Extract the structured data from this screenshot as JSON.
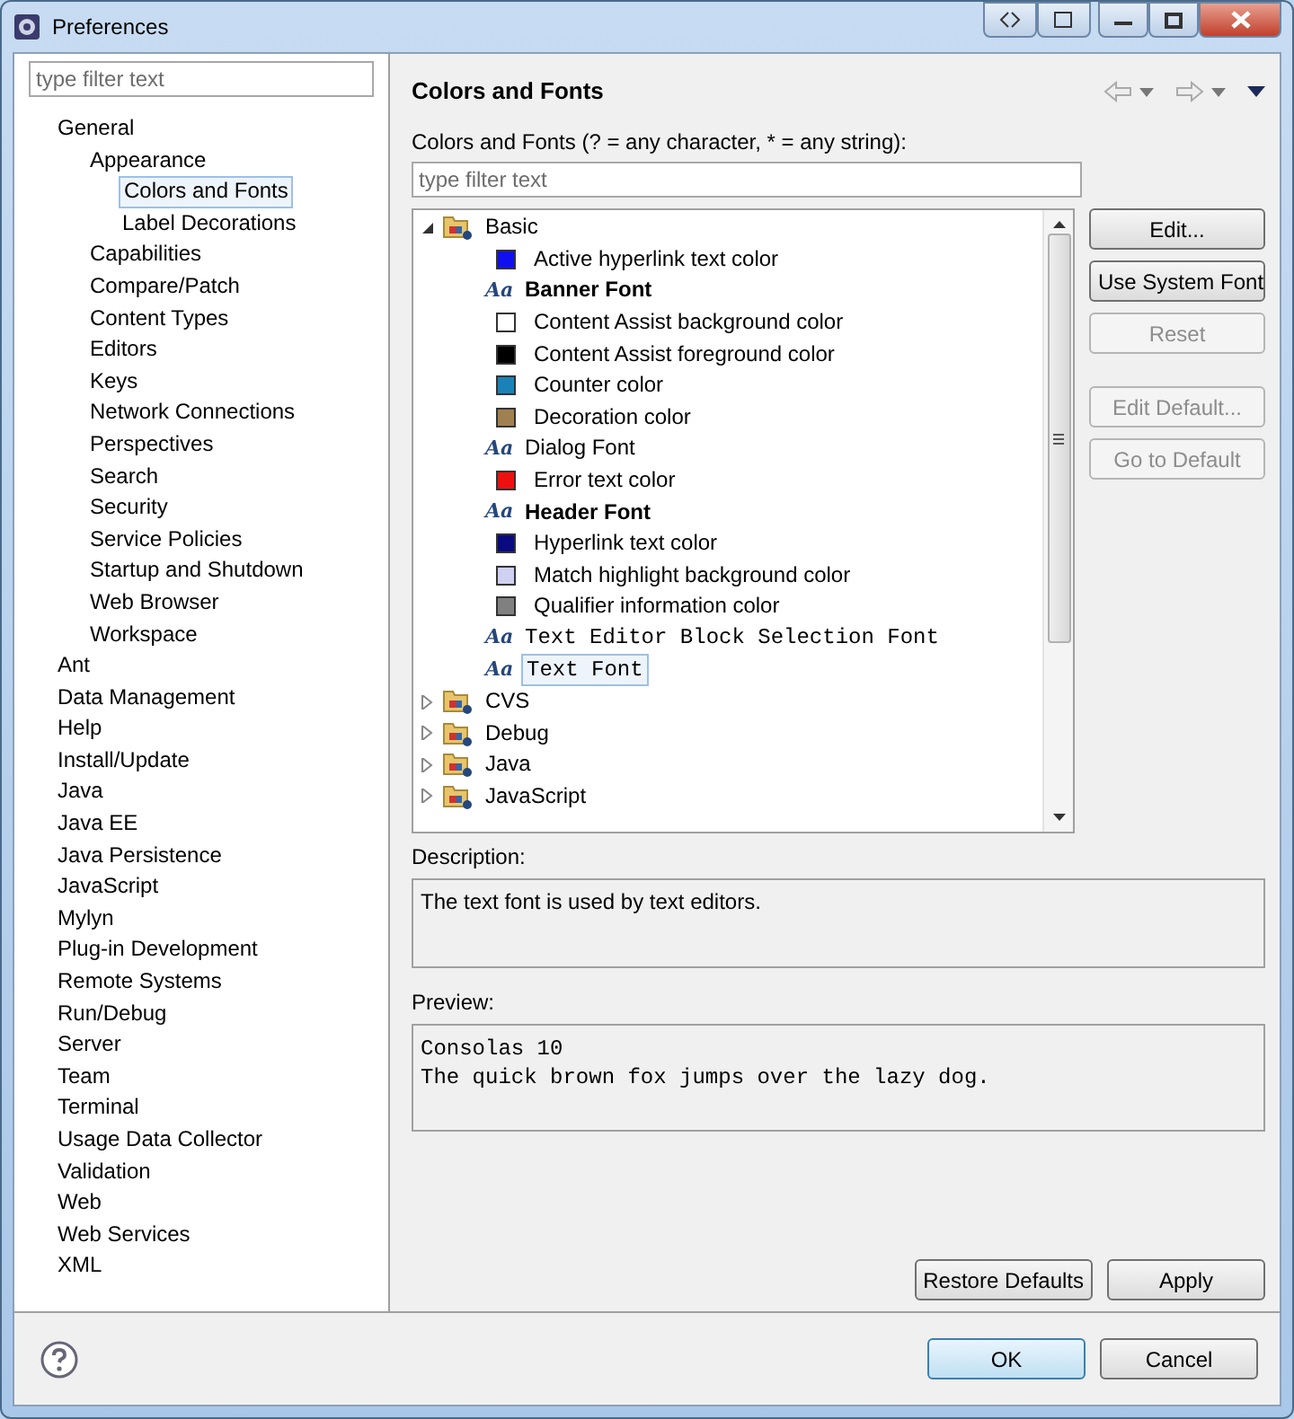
{
  "window": {
    "title": "Preferences"
  },
  "filter": {
    "placeholder": "type filter text"
  },
  "nav_tree": [
    {
      "label": "General",
      "selected": false,
      "children": [
        {
          "label": "Appearance",
          "selected": false,
          "children": [
            {
              "label": "Colors and Fonts",
              "selected": true
            },
            {
              "label": "Label Decorations",
              "selected": false
            }
          ]
        },
        {
          "label": "Capabilities",
          "selected": false
        },
        {
          "label": "Compare/Patch",
          "selected": false
        },
        {
          "label": "Content Types",
          "selected": false
        },
        {
          "label": "Editors",
          "selected": false
        },
        {
          "label": "Keys",
          "selected": false
        },
        {
          "label": "Network Connections",
          "selected": false
        },
        {
          "label": "Perspectives",
          "selected": false
        },
        {
          "label": "Search",
          "selected": false
        },
        {
          "label": "Security",
          "selected": false
        },
        {
          "label": "Service Policies",
          "selected": false
        },
        {
          "label": "Startup and Shutdown",
          "selected": false
        },
        {
          "label": "Web Browser",
          "selected": false
        },
        {
          "label": "Workspace",
          "selected": false
        }
      ]
    },
    {
      "label": "Ant",
      "selected": false
    },
    {
      "label": "Data Management",
      "selected": false
    },
    {
      "label": "Help",
      "selected": false
    },
    {
      "label": "Install/Update",
      "selected": false
    },
    {
      "label": "Java",
      "selected": false
    },
    {
      "label": "Java EE",
      "selected": false
    },
    {
      "label": "Java Persistence",
      "selected": false
    },
    {
      "label": "JavaScript",
      "selected": false
    },
    {
      "label": "Mylyn",
      "selected": false
    },
    {
      "label": "Plug-in Development",
      "selected": false
    },
    {
      "label": "Remote Systems",
      "selected": false
    },
    {
      "label": "Run/Debug",
      "selected": false
    },
    {
      "label": "Server",
      "selected": false
    },
    {
      "label": "Team",
      "selected": false
    },
    {
      "label": "Terminal",
      "selected": false
    },
    {
      "label": "Usage Data Collector",
      "selected": false
    },
    {
      "label": "Validation",
      "selected": false
    },
    {
      "label": "Web",
      "selected": false
    },
    {
      "label": "Web Services",
      "selected": false
    },
    {
      "label": "XML",
      "selected": false
    }
  ],
  "page": {
    "title": "Colors and Fonts",
    "filter_label": "Colors and Fonts (? = any character, * = any string):",
    "filter_placeholder": "type filter text"
  },
  "font_tree": [
    {
      "label": "Basic",
      "expanded": true,
      "selected": false,
      "children": [
        {
          "kind": "color",
          "label": "Active hyperlink text color",
          "color": "#1010ee",
          "selected": false
        },
        {
          "kind": "boldfont",
          "icon": "Aa",
          "label": "Banner Font",
          "selected": false
        },
        {
          "kind": "color",
          "label": "Content Assist background color",
          "color": "#ffffff",
          "selected": false
        },
        {
          "kind": "color",
          "label": "Content Assist foreground color",
          "color": "#000000",
          "selected": false
        },
        {
          "kind": "color",
          "label": "Counter color",
          "color": "#1a82b8",
          "selected": false
        },
        {
          "kind": "color",
          "label": "Decoration color",
          "color": "#a08050",
          "selected": false
        },
        {
          "kind": "font",
          "icon": "Aa",
          "label": "Dialog Font",
          "selected": false
        },
        {
          "kind": "color",
          "label": "Error text color",
          "color": "#ee1010",
          "selected": false
        },
        {
          "kind": "boldfont",
          "icon": "Aa",
          "label": "Header Font",
          "selected": false
        },
        {
          "kind": "color",
          "label": "Hyperlink text color",
          "color": "#0a0a80",
          "selected": false
        },
        {
          "kind": "color",
          "label": "Match highlight background color",
          "color": "#d0d0f0",
          "selected": false
        },
        {
          "kind": "color",
          "label": "Qualifier information color",
          "color": "#808080",
          "selected": false
        },
        {
          "kind": "monofont",
          "icon": "Aa",
          "label": "Text Editor Block Selection Font",
          "selected": false
        },
        {
          "kind": "monofont",
          "icon": "Aa",
          "label": "Text Font",
          "selected": true
        }
      ]
    },
    {
      "label": "CVS",
      "expanded": false,
      "selected": false
    },
    {
      "label": "Debug",
      "expanded": false,
      "selected": false
    },
    {
      "label": "Java",
      "expanded": false,
      "selected": false
    },
    {
      "label": "JavaScript",
      "expanded": false,
      "selected": false
    }
  ],
  "side_buttons": [
    {
      "label": "Edit...",
      "disabled": false
    },
    {
      "label": "Use System Font",
      "disabled": false
    },
    {
      "label": "Reset",
      "disabled": true
    },
    {
      "label": "Edit Default...",
      "disabled": true
    },
    {
      "label": "Go to Default",
      "disabled": true
    }
  ],
  "description": {
    "label": "Description:",
    "text": "The text font is used by text editors."
  },
  "preview": {
    "label": "Preview:",
    "lines": [
      "Consolas 10",
      "The quick brown fox jumps over the lazy dog."
    ]
  },
  "page_buttons": [
    {
      "label": "Restore Defaults"
    },
    {
      "label": "Apply"
    }
  ],
  "dialog_buttons": [
    {
      "label": "OK",
      "default": true
    },
    {
      "label": "Cancel",
      "default": false
    }
  ]
}
